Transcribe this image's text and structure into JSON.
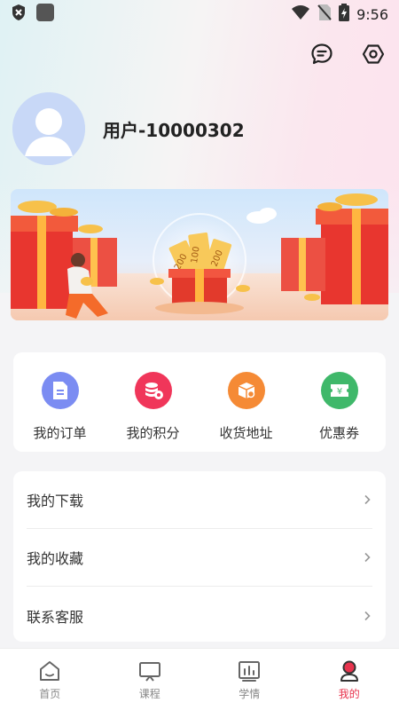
{
  "status_bar": {
    "time": "9:56"
  },
  "header": {
    "message_icon": "message-icon",
    "settings_icon": "settings-hexagon-icon"
  },
  "profile": {
    "username": "用户-10000302"
  },
  "banner": {
    "ticket_text_1": "200",
    "ticket_text_2": "100",
    "ticket_text_3": "200"
  },
  "quick_actions": [
    {
      "label": "我的订单",
      "icon": "order-icon",
      "color": "#7b8cf2"
    },
    {
      "label": "我的积分",
      "icon": "points-icon",
      "color": "#f0365a"
    },
    {
      "label": "收货地址",
      "icon": "address-box-icon",
      "color": "#f58a35"
    },
    {
      "label": "优惠券",
      "icon": "coupon-icon",
      "color": "#3fb86a"
    }
  ],
  "menu": [
    {
      "label": "我的下载"
    },
    {
      "label": "我的收藏"
    },
    {
      "label": "联系客服"
    }
  ],
  "tabs": [
    {
      "label": "首页",
      "icon": "home-icon"
    },
    {
      "label": "课程",
      "icon": "course-icon"
    },
    {
      "label": "学情",
      "icon": "stats-icon"
    },
    {
      "label": "我的",
      "icon": "profile-icon",
      "active": true
    }
  ],
  "colors": {
    "accent": "#e8344e"
  }
}
